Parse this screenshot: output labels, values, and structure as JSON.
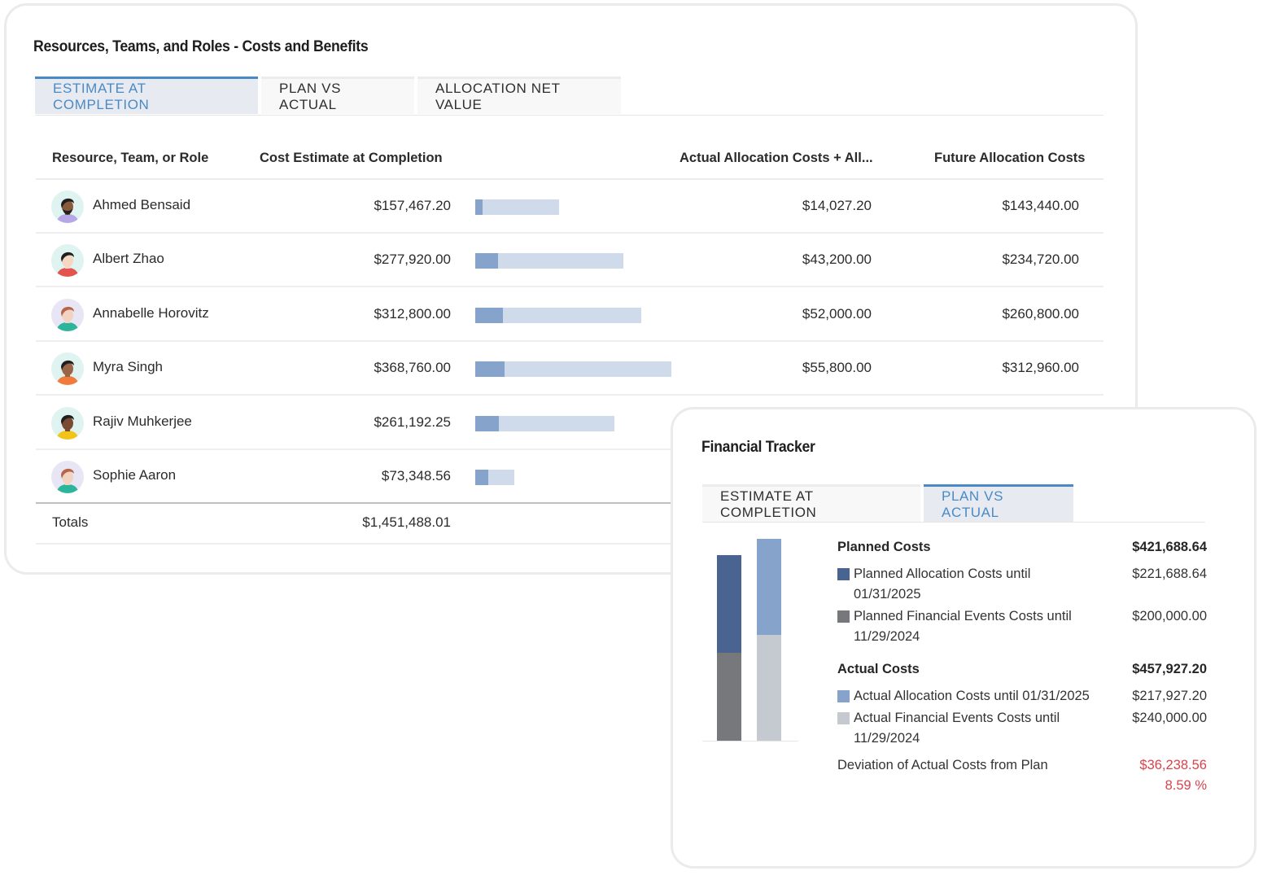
{
  "resources_card": {
    "title": "Resources, Teams, and Roles - Costs and Benefits",
    "tabs": [
      {
        "label": "ESTIMATE AT COMPLETION",
        "active": true
      },
      {
        "label": "PLAN VS ACTUAL",
        "active": false
      },
      {
        "label": "ALLOCATION NET VALUE",
        "active": false
      }
    ],
    "columns": {
      "name": "Resource, Team, or Role",
      "cost": "Cost Estimate at Completion",
      "actual": "Actual Allocation Costs + All...",
      "future": "Future Allocation Costs"
    },
    "rows": [
      {
        "name": "Ahmed Bensaid",
        "cost": "$157,467.20",
        "cost_value": 157467.2,
        "actual": "$14,027.20",
        "actual_value": 14027.2,
        "future": "$143,440.00",
        "avatar": {
          "bg": "#dff3f1",
          "hair": "#1f1f1f",
          "skin": "#8a5a3c",
          "shirt": "#b6a7e6",
          "beard": true
        }
      },
      {
        "name": "Albert Zhao",
        "cost": "$277,920.00",
        "cost_value": 277920.0,
        "actual": "$43,200.00",
        "actual_value": 43200.0,
        "future": "$234,720.00",
        "avatar": {
          "bg": "#dff3f1",
          "hair": "#1f1f1f",
          "skin": "#f4d6c3",
          "shirt": "#e4544e",
          "beard": false
        }
      },
      {
        "name": "Annabelle Horovitz",
        "cost": "$312,800.00",
        "cost_value": 312800.0,
        "actual": "$52,000.00",
        "actual_value": 52000.0,
        "future": "$260,800.00",
        "avatar": {
          "bg": "#e8e6f4",
          "hair": "#b5664a",
          "skin": "#f2d2c0",
          "shirt": "#2bb59a",
          "beard": false
        }
      },
      {
        "name": "Myra Singh",
        "cost": "$368,760.00",
        "cost_value": 368760.0,
        "actual": "$55,800.00",
        "actual_value": 55800.0,
        "future": "$312,960.00",
        "avatar": {
          "bg": "#dff3f1",
          "hair": "#1f1f1f",
          "skin": "#9a6547",
          "shirt": "#f27b3c",
          "beard": false
        }
      },
      {
        "name": "Rajiv Muhkerjee",
        "cost": "$261,192.25",
        "cost_value": 261192.25,
        "actual": "",
        "actual_value": null,
        "future": "",
        "avatar": {
          "bg": "#dff3f1",
          "hair": "#1f1f1f",
          "skin": "#7a4a33",
          "shirt": "#f2c417",
          "beard": false
        }
      },
      {
        "name": "Sophie Aaron",
        "cost": "$73,348.56",
        "cost_value": 73348.56,
        "actual": "",
        "actual_value": null,
        "future": "",
        "avatar": {
          "bg": "#e8e6f4",
          "hair": "#b5664a",
          "skin": "#f2d2c0",
          "shirt": "#2bb59a",
          "beard": false
        }
      }
    ],
    "bar_actual_fraction": [
      0.089,
      0.155,
      0.166,
      0.151,
      0.17,
      0.33
    ],
    "totals_label": "Totals",
    "totals_cost": "$1,451,488.01"
  },
  "tracker_card": {
    "title": "Financial Tracker",
    "tabs": [
      {
        "label": "ESTIMATE AT COMPLETION",
        "active": false
      },
      {
        "label": "PLAN VS ACTUAL",
        "active": true
      }
    ],
    "planned": {
      "label": "Planned Costs",
      "total": "$421,688.64",
      "items": [
        {
          "label": "Planned Allocation Costs until 01/31/2025",
          "value": "$221,688.64",
          "color": "#4a6491"
        },
        {
          "label": "Planned Financial Events Costs until 11/29/2024",
          "value": "$200,000.00",
          "color": "#76787c"
        }
      ]
    },
    "actual": {
      "label": "Actual Costs",
      "total": "$457,927.20",
      "items": [
        {
          "label": "Actual Allocation Costs until 01/31/2025",
          "value": "$217,927.20",
          "color": "#86a4cb"
        },
        {
          "label": "Actual Financial Events Costs until 11/29/2024",
          "value": "$240,000.00",
          "color": "#c5cad1"
        }
      ]
    },
    "deviation": {
      "label": "Deviation of Actual Costs from Plan",
      "amount": "$36,238.56",
      "percent": "8.59 %",
      "color": "#d9434c"
    }
  },
  "chart_data": {
    "type": "bar",
    "stacked": true,
    "categories": [
      "Planned Costs",
      "Actual Costs"
    ],
    "series": [
      {
        "name": "Financial Events Costs",
        "values": [
          200000.0,
          240000.0
        ],
        "colors": [
          "#76787c",
          "#c5cad1"
        ]
      },
      {
        "name": "Allocation Costs",
        "values": [
          221688.64,
          217927.2
        ],
        "colors": [
          "#4a6491",
          "#86a4cb"
        ]
      }
    ],
    "title": "",
    "xlabel": "",
    "ylabel": "",
    "ylim": [
      0,
      457927.2
    ],
    "grid": false,
    "legend": "right"
  }
}
